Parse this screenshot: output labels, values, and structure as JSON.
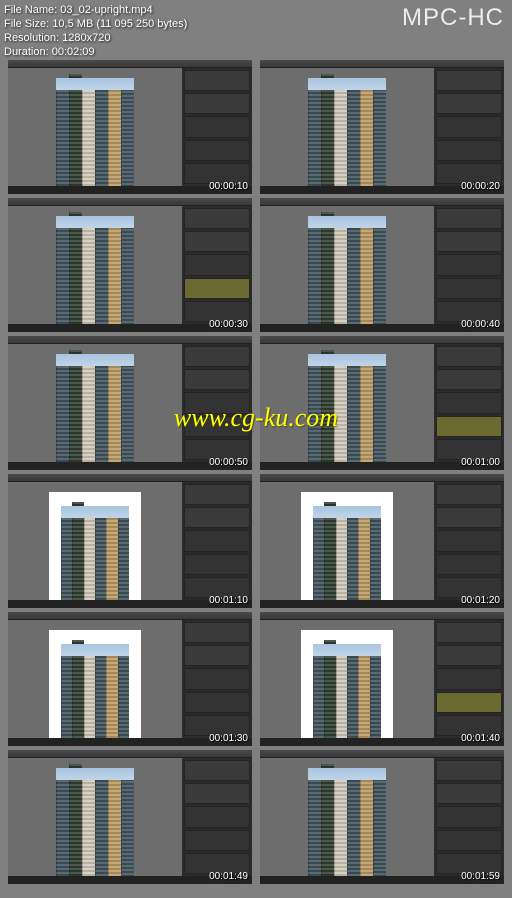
{
  "app_name": "MPC-HC",
  "info": {
    "file_name_label": "File Name:",
    "file_name": "03_02-upright.mp4",
    "file_size_label": "File Size:",
    "file_size": "10,5 MB (11 095 250 bytes)",
    "resolution_label": "Resolution:",
    "resolution": "1280x720",
    "duration_label": "Duration:",
    "duration": "00:02:09"
  },
  "watermark": "www.cg-ku.com",
  "thumbs": [
    {
      "time": "00:00:10",
      "panel_highlight": false,
      "white_bg": false
    },
    {
      "time": "00:00:20",
      "panel_highlight": false,
      "white_bg": false
    },
    {
      "time": "00:00:30",
      "panel_highlight": true,
      "white_bg": false
    },
    {
      "time": "00:00:40",
      "panel_highlight": false,
      "white_bg": false
    },
    {
      "time": "00:00:50",
      "panel_highlight": false,
      "white_bg": false
    },
    {
      "time": "00:01:00",
      "panel_highlight": true,
      "white_bg": false
    },
    {
      "time": "00:01:10",
      "panel_highlight": false,
      "white_bg": true
    },
    {
      "time": "00:01:20",
      "panel_highlight": false,
      "white_bg": true
    },
    {
      "time": "00:01:30",
      "panel_highlight": false,
      "white_bg": true
    },
    {
      "time": "00:01:40",
      "panel_highlight": true,
      "white_bg": true
    },
    {
      "time": "00:01:49",
      "panel_highlight": false,
      "white_bg": false
    },
    {
      "time": "00:01:59",
      "panel_highlight": false,
      "white_bg": false
    }
  ]
}
